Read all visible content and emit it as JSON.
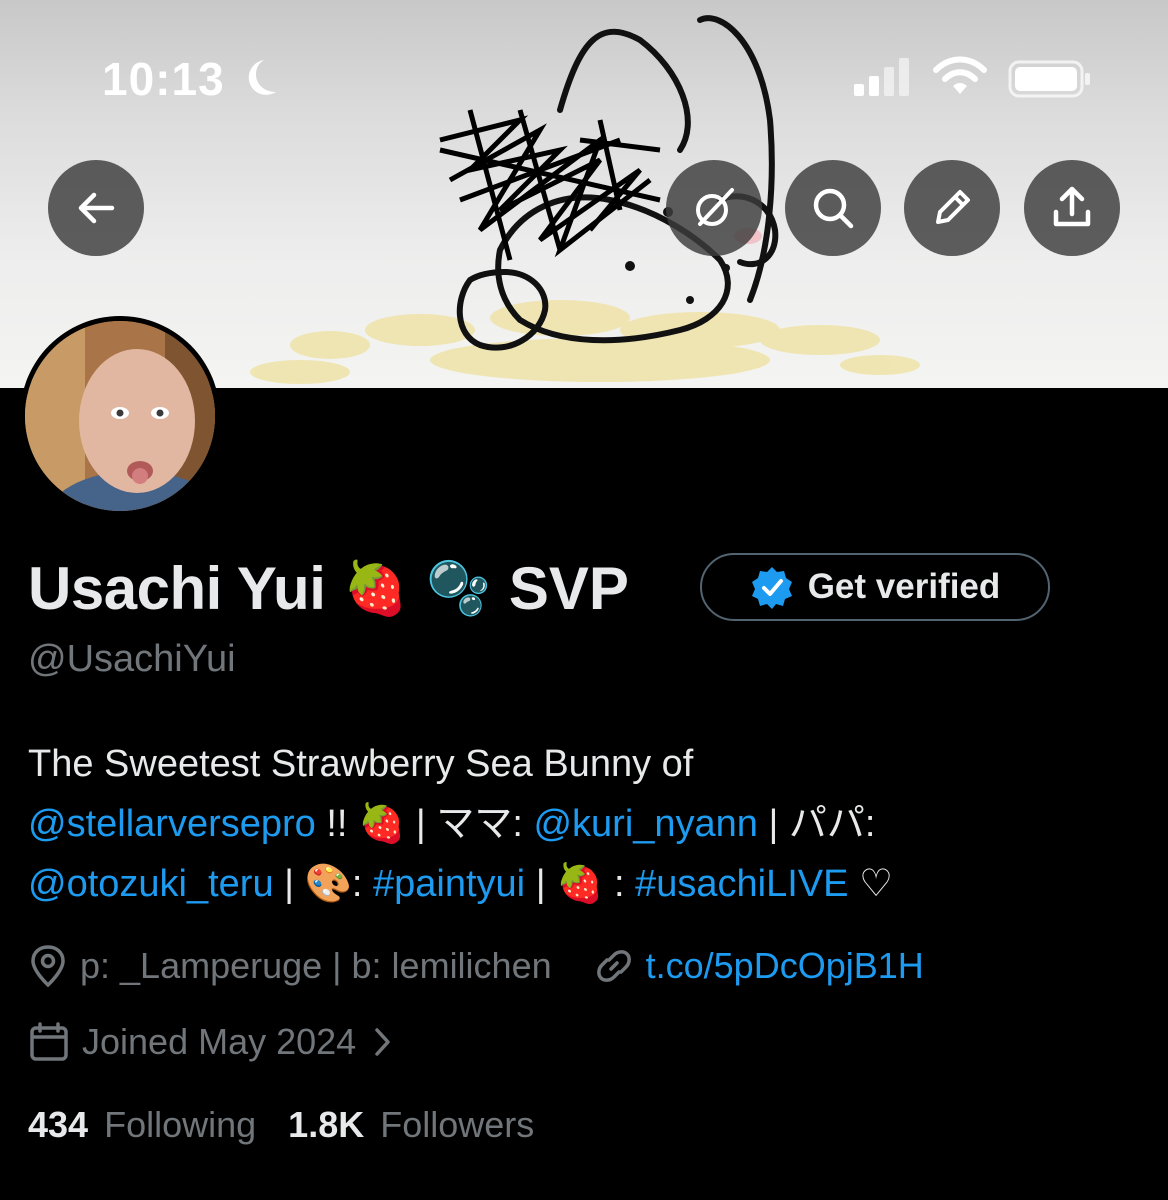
{
  "status_bar": {
    "time": "10:13",
    "icons": [
      "moon-icon",
      "cellular-signal-icon",
      "wifi-icon",
      "battery-icon"
    ]
  },
  "toolbar": {
    "buttons": [
      "back-arrow-icon",
      "grok-icon",
      "search-icon",
      "edit-pencil-icon",
      "share-icon"
    ]
  },
  "profile": {
    "display_name": "Usachi Yui",
    "name_emoji_1": "🍓",
    "name_emoji_2": "🫧",
    "name_suffix": "SVP",
    "get_verified_label": "Get verified",
    "handle": "@UsachiYui",
    "bio": {
      "line1": "The Sweetest Strawberry Sea Bunny of",
      "mention_1": "@stellarversepro",
      "text_1": " !! 🍓  | ママ: ",
      "mention_2": "@kuri_nyann",
      "text_2": " | パパ:",
      "mention_3": "@otozuki_teru",
      "text_3": " | 🎨: ",
      "hashtag_1": "#paintyui",
      "text_4": " | 🍓 : ",
      "hashtag_2": "#usachiLIVE",
      "text_5": " ♡"
    },
    "location": "p: _Lamperuge | b: lemilichen",
    "url": "t.co/5pDcOpjB1H",
    "joined": "Joined May 2024",
    "following_count": "434",
    "following_label": "Following",
    "followers_count": "1.8K",
    "followers_label": "Followers"
  },
  "colors": {
    "background": "#000000",
    "accent_blue": "#1d9bf0",
    "secondary_text": "#71767b",
    "primary_text": "#e7e9ea"
  }
}
